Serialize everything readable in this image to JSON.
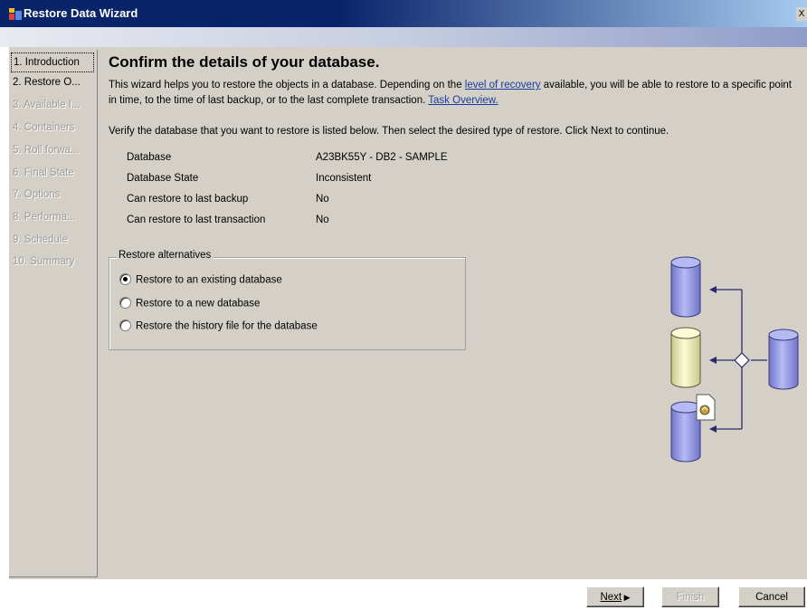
{
  "window": {
    "title": "Restore Data Wizard",
    "close_label": "X"
  },
  "steps": [
    {
      "label": "1. Introduction",
      "state": "current"
    },
    {
      "label": "2. Restore O...",
      "state": "enabled"
    },
    {
      "label": "3. Available I...",
      "state": "disabled"
    },
    {
      "label": "4. Containers",
      "state": "disabled"
    },
    {
      "label": "5. Roll forwa...",
      "state": "disabled"
    },
    {
      "label": "6. Final State",
      "state": "disabled"
    },
    {
      "label": "7. Options",
      "state": "disabled"
    },
    {
      "label": "8. Performa...",
      "state": "disabled"
    },
    {
      "label": "9. Schedule",
      "state": "disabled"
    },
    {
      "label": "10. Summary",
      "state": "disabled"
    }
  ],
  "main": {
    "heading": "Confirm the details of your database.",
    "intro_part1": "This wizard helps you to restore the objects in a database. Depending on the ",
    "intro_link": "level of recovery",
    "intro_part2": " available, you will be able to restore to a specific point in time, to the time of last backup, or to the last complete transaction. ",
    "task_link": "Task Overview.",
    "verify_text": "Verify the database that you want to restore is listed below. Then select the desired type of restore. Click Next to continue.",
    "info": [
      {
        "label": "Database",
        "value": "A23BK55Y - DB2 - SAMPLE"
      },
      {
        "label": "Database State",
        "value": "Inconsistent"
      },
      {
        "label": "Can restore to last backup",
        "value": "No"
      },
      {
        "label": "Can restore to last transaction",
        "value": "No"
      }
    ],
    "group_title": "Restore alternatives",
    "options": [
      {
        "label": "Restore to an existing database",
        "checked": true
      },
      {
        "label": "Restore to a new database",
        "checked": false
      },
      {
        "label": "Restore the history file for the database",
        "checked": false
      }
    ]
  },
  "buttons": {
    "next": "Next",
    "finish": "Finish",
    "cancel": "Cancel"
  },
  "colors": {
    "title_bar": "#0a246a",
    "panel": "#d4d0c8",
    "link": "#1a3c9c",
    "cylinder_blue": "#8f95e6",
    "cylinder_yellow": "#eeeeaa"
  },
  "icons": {
    "app": "restore-wizard-app-icon",
    "illustration": "database-restore-diagram-icon"
  }
}
